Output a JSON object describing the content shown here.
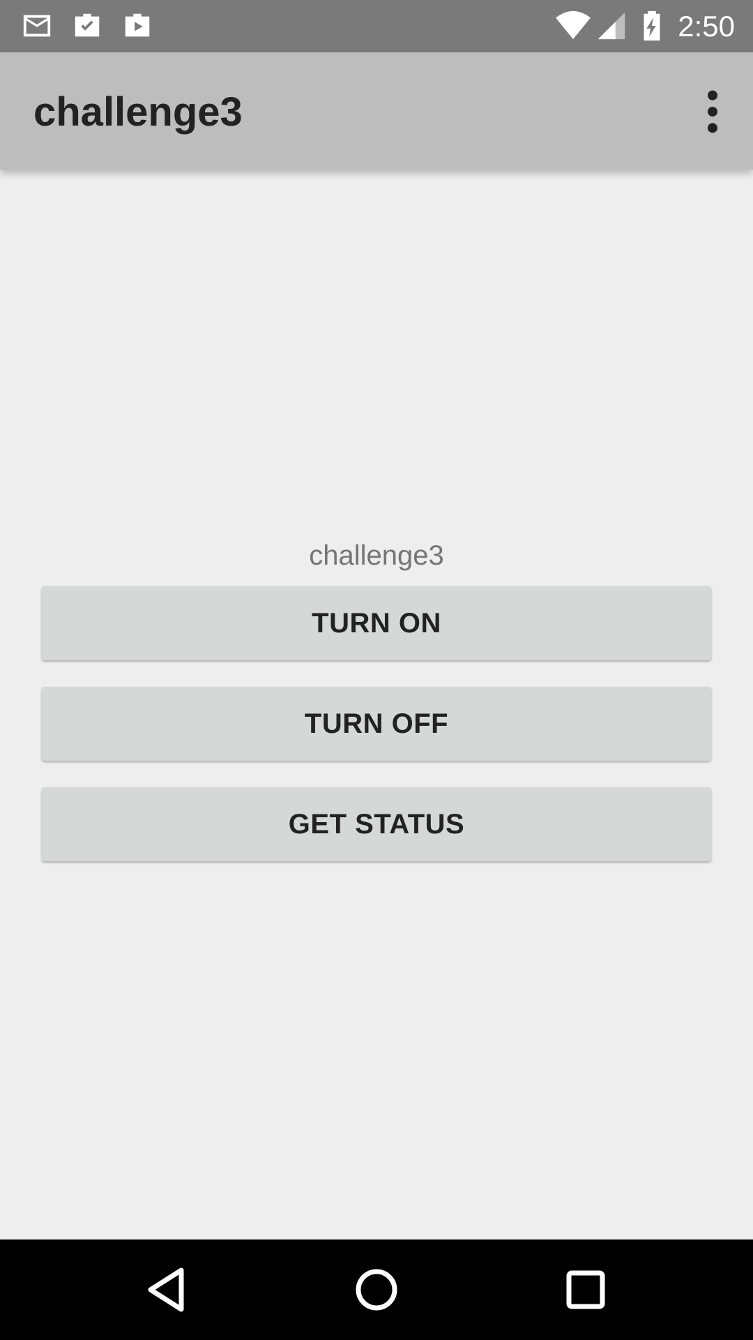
{
  "status_bar": {
    "time": "2:50",
    "icons": [
      "gmail-icon",
      "work-check-icon",
      "work-play-icon",
      "wifi-icon",
      "cell-signal-icon",
      "battery-charging-icon"
    ]
  },
  "app_bar": {
    "title": "challenge3",
    "overflow_icon": "more-vert-icon"
  },
  "main": {
    "label": "challenge3",
    "buttons": [
      {
        "label": "TURN ON"
      },
      {
        "label": "TURN OFF"
      },
      {
        "label": "GET STATUS"
      }
    ]
  },
  "nav_bar": {
    "icons": [
      "back-icon",
      "home-icon",
      "recents-icon"
    ]
  },
  "colors": {
    "status_bar": "#7a7a7a",
    "app_bar": "#bdbdbd",
    "background": "#eeeeee",
    "button": "#d6d7d7",
    "nav_bar": "#000000"
  }
}
